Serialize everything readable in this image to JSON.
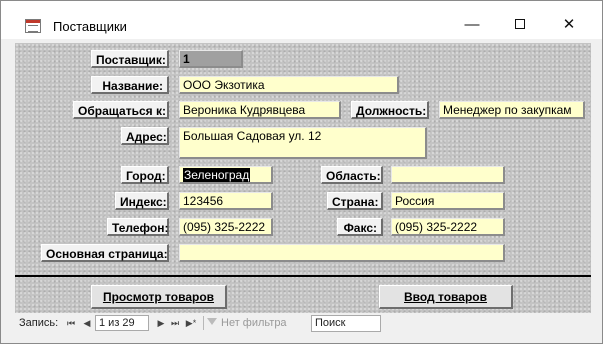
{
  "window": {
    "title": "Поставщики",
    "minimize": "—",
    "close": "✕"
  },
  "form": {
    "supplier_label": "Поставщик:",
    "supplier_value": "1",
    "name_label": "Название:",
    "name_value": "ООО Экзотика",
    "contact_label": "Обращаться к:",
    "contact_value": "Вероника Кудрявцева",
    "position_label": "Должность:",
    "position_value": "Менеджер по закупкам",
    "address_label": "Адрес:",
    "address_value": "Большая Садовая ул. 12",
    "city_label": "Город:",
    "city_value": "Зеленоград",
    "region_label": "Область:",
    "region_value": "",
    "zip_label": "Индекс:",
    "zip_value": "123456",
    "country_label": "Страна:",
    "country_value": "Россия",
    "phone_label": "Телефон:",
    "phone_value": "(095) 325-2222",
    "fax_label": "Факс:",
    "fax_value": "(095) 325-2222",
    "homepage_label": "Основная страница:",
    "homepage_value": ""
  },
  "buttons": {
    "view_products": "Просмотр товаров",
    "enter_products": "Ввод товаров"
  },
  "navbar": {
    "record_label": "Запись:",
    "first": "⏮",
    "prev": "◀",
    "counter": "1 из 29",
    "next": "▶",
    "last": "⏭",
    "new": "▶*",
    "filter": "Нет фильтра",
    "search": "Поиск"
  }
}
